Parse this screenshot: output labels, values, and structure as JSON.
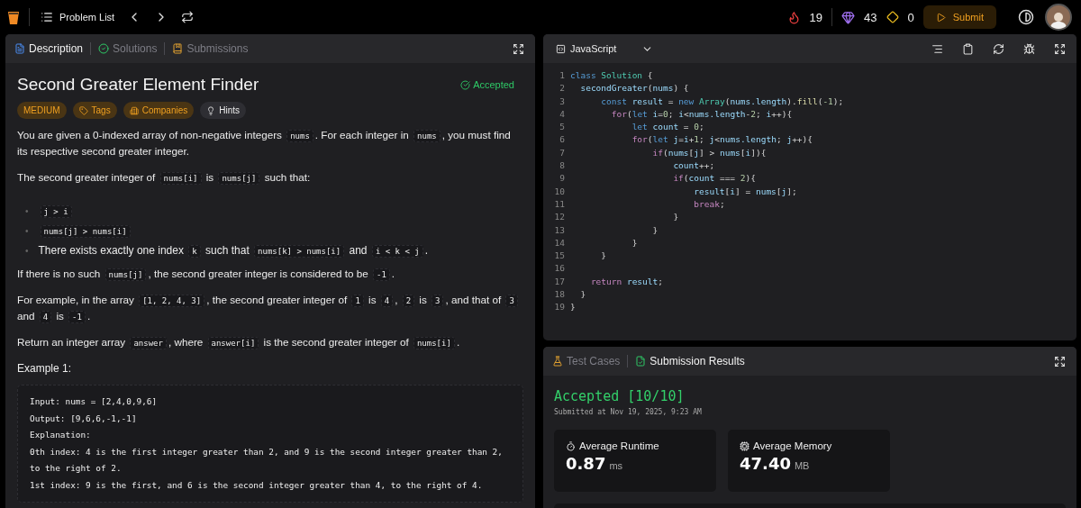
{
  "top_bar": {
    "nav_label": "Problem List",
    "streak": "19",
    "gems": "43",
    "diamonds": "0",
    "submit": "Submit"
  },
  "description_panel": {
    "tabs": [
      {
        "label": "Description",
        "selected": true
      },
      {
        "label": "Solutions",
        "selected": false
      },
      {
        "label": "Submissions",
        "selected": false
      }
    ],
    "title": "Second Greater Element Finder",
    "status": "Accepted",
    "tags": [
      {
        "label": "MEDIUM",
        "kind": "difficulty"
      },
      {
        "label": "Tags",
        "kind": "tags"
      },
      {
        "label": "Companies",
        "kind": "companies"
      },
      {
        "label": "Hints",
        "kind": "hints"
      }
    ],
    "content": [
      {
        "kind": "paragraph",
        "parts": [
          {
            "kind": "text",
            "text": "You are given a 0-indexed array of non-negative integers "
          },
          {
            "kind": "code",
            "text": "nums"
          },
          {
            "kind": "text",
            "text": ". For each integer in "
          },
          {
            "kind": "code",
            "text": "nums"
          },
          {
            "kind": "text",
            "text": ", you must find its respective second greater integer."
          }
        ]
      },
      {
        "kind": "paragraph",
        "parts": [
          {
            "kind": "text",
            "text": "The second greater integer of "
          },
          {
            "kind": "code",
            "text": "nums[i]"
          },
          {
            "kind": "text",
            "text": " is "
          },
          {
            "kind": "code",
            "text": "nums[j]"
          },
          {
            "kind": "text",
            "text": " such that:"
          }
        ]
      },
      {
        "kind": "bullets",
        "items": [
          {
            "marker": "•",
            "parts": [
              {
                "kind": "code",
                "text": "j > i"
              }
            ]
          },
          {
            "marker": "•",
            "parts": [
              {
                "kind": "code",
                "text": "nums[j] > nums[i]"
              }
            ]
          },
          {
            "marker": "•",
            "parts": [
              {
                "kind": "text",
                "text": "There exists exactly one index "
              },
              {
                "kind": "code",
                "text": "k"
              },
              {
                "kind": "text",
                "text": " such that "
              },
              {
                "kind": "code",
                "text": "nums[k] > nums[i]"
              },
              {
                "kind": "text",
                "text": " and "
              },
              {
                "kind": "code",
                "text": "i < k < j"
              },
              {
                "kind": "text",
                "text": "."
              }
            ]
          }
        ]
      },
      {
        "kind": "paragraph",
        "parts": [
          {
            "kind": "text",
            "text": "If there is no such "
          },
          {
            "kind": "code",
            "text": "nums[j]"
          },
          {
            "kind": "text",
            "text": ", the second greater integer is considered to be "
          },
          {
            "kind": "code",
            "text": "-1"
          },
          {
            "kind": "text",
            "text": "."
          }
        ]
      },
      {
        "kind": "paragraph",
        "parts": [
          {
            "kind": "text",
            "text": "For example, in the array "
          },
          {
            "kind": "code",
            "text": "[1, 2, 4, 3]"
          },
          {
            "kind": "text",
            "text": ", the second greater integer of "
          },
          {
            "kind": "code",
            "text": "1"
          },
          {
            "kind": "text",
            "text": " is "
          },
          {
            "kind": "code",
            "text": "4"
          },
          {
            "kind": "text",
            "text": ", "
          },
          {
            "kind": "code",
            "text": "2"
          },
          {
            "kind": "text",
            "text": " is "
          },
          {
            "kind": "code",
            "text": "3"
          },
          {
            "kind": "text",
            "text": ", and that of "
          },
          {
            "kind": "code",
            "text": "3"
          },
          {
            "kind": "text",
            "text": " and "
          },
          {
            "kind": "code",
            "text": "4"
          },
          {
            "kind": "text",
            "text": " is "
          },
          {
            "kind": "code",
            "text": "-1"
          },
          {
            "kind": "text",
            "text": "."
          }
        ]
      },
      {
        "kind": "paragraph",
        "parts": [
          {
            "kind": "text",
            "text": "Return an integer array "
          },
          {
            "kind": "code",
            "text": "answer"
          },
          {
            "kind": "text",
            "text": ", where "
          },
          {
            "kind": "code",
            "text": "answer[i]"
          },
          {
            "kind": "text",
            "text": " is the second greater integer of "
          },
          {
            "kind": "code",
            "text": "nums[i]"
          },
          {
            "kind": "text",
            "text": "."
          }
        ]
      },
      {
        "kind": "heading",
        "text": "Example 1:"
      },
      {
        "kind": "example",
        "lines": [
          "Input: nums = [2,4,0,9,6]",
          "Output: [9,6,6,-1,-1]",
          "Explanation:",
          "0th index: 4 is the first integer greater than 2, and 9 is the second integer greater than 2, to the right of 2.",
          "1st index: 9 is the first, and 6 is the second integer greater than 4, to the right of 4."
        ]
      }
    ]
  },
  "editor": {
    "language": "JavaScript",
    "lines": [
      {
        "number": "1",
        "tokens": [
          {
            "kind": "keyword",
            "text": "class "
          },
          {
            "kind": "class",
            "text": "Solution"
          },
          {
            "kind": "plain",
            "text": " {"
          }
        ]
      },
      {
        "number": "2",
        "tokens": [
          {
            "kind": "var",
            "text": "  secondGreater"
          },
          {
            "kind": "plain",
            "text": "("
          },
          {
            "kind": "var",
            "text": "nums"
          },
          {
            "kind": "plain",
            "text": ") {"
          }
        ]
      },
      {
        "number": "3",
        "tokens": [
          {
            "kind": "keyword",
            "text": "      const "
          },
          {
            "kind": "var",
            "text": "result"
          },
          {
            "kind": "plain",
            "text": " = "
          },
          {
            "kind": "keyword",
            "text": "new "
          },
          {
            "kind": "class",
            "text": "Array"
          },
          {
            "kind": "plain",
            "text": "("
          },
          {
            "kind": "var",
            "text": "nums.length"
          },
          {
            "kind": "plain",
            "text": ")."
          },
          {
            "kind": "func",
            "text": "fill"
          },
          {
            "kind": "plain",
            "text": "("
          },
          {
            "kind": "number",
            "text": "-1"
          },
          {
            "kind": "plain",
            "text": ");"
          }
        ]
      },
      {
        "number": "4",
        "tokens": [
          {
            "kind": "control",
            "text": "        for"
          },
          {
            "kind": "plain",
            "text": "("
          },
          {
            "kind": "keyword",
            "text": "let "
          },
          {
            "kind": "var",
            "text": "i"
          },
          {
            "kind": "plain",
            "text": "="
          },
          {
            "kind": "number",
            "text": "0"
          },
          {
            "kind": "plain",
            "text": "; "
          },
          {
            "kind": "var",
            "text": "i"
          },
          {
            "kind": "plain",
            "text": "<"
          },
          {
            "kind": "var",
            "text": "nums.length"
          },
          {
            "kind": "plain",
            "text": "-"
          },
          {
            "kind": "number",
            "text": "2"
          },
          {
            "kind": "plain",
            "text": "; "
          },
          {
            "kind": "var",
            "text": "i"
          },
          {
            "kind": "plain",
            "text": "++){"
          }
        ]
      },
      {
        "number": "5",
        "tokens": [
          {
            "kind": "keyword",
            "text": "            let "
          },
          {
            "kind": "var",
            "text": "count"
          },
          {
            "kind": "plain",
            "text": " = "
          },
          {
            "kind": "number",
            "text": "0"
          },
          {
            "kind": "plain",
            "text": ";"
          }
        ]
      },
      {
        "number": "6",
        "tokens": [
          {
            "kind": "control",
            "text": "            for"
          },
          {
            "kind": "plain",
            "text": "("
          },
          {
            "kind": "keyword",
            "text": "let "
          },
          {
            "kind": "var",
            "text": "j"
          },
          {
            "kind": "plain",
            "text": "="
          },
          {
            "kind": "var",
            "text": "i"
          },
          {
            "kind": "plain",
            "text": "+"
          },
          {
            "kind": "number",
            "text": "1"
          },
          {
            "kind": "plain",
            "text": "; "
          },
          {
            "kind": "var",
            "text": "j"
          },
          {
            "kind": "plain",
            "text": "<"
          },
          {
            "kind": "var",
            "text": "nums.length"
          },
          {
            "kind": "plain",
            "text": "; "
          },
          {
            "kind": "var",
            "text": "j"
          },
          {
            "kind": "plain",
            "text": "++){"
          }
        ]
      },
      {
        "number": "7",
        "tokens": [
          {
            "kind": "control",
            "text": "                if"
          },
          {
            "kind": "plain",
            "text": "("
          },
          {
            "kind": "var",
            "text": "nums"
          },
          {
            "kind": "plain",
            "text": "["
          },
          {
            "kind": "var",
            "text": "j"
          },
          {
            "kind": "plain",
            "text": "] > "
          },
          {
            "kind": "var",
            "text": "nums"
          },
          {
            "kind": "plain",
            "text": "["
          },
          {
            "kind": "var",
            "text": "i"
          },
          {
            "kind": "plain",
            "text": "]){"
          }
        ]
      },
      {
        "number": "8",
        "tokens": [
          {
            "kind": "var",
            "text": "                    count"
          },
          {
            "kind": "plain",
            "text": "++;"
          }
        ]
      },
      {
        "number": "9",
        "tokens": [
          {
            "kind": "control",
            "text": "                    if"
          },
          {
            "kind": "plain",
            "text": "("
          },
          {
            "kind": "var",
            "text": "count"
          },
          {
            "kind": "plain",
            "text": " === "
          },
          {
            "kind": "number",
            "text": "2"
          },
          {
            "kind": "plain",
            "text": "){"
          }
        ]
      },
      {
        "number": "10",
        "tokens": [
          {
            "kind": "var",
            "text": "                        result"
          },
          {
            "kind": "plain",
            "text": "["
          },
          {
            "kind": "var",
            "text": "i"
          },
          {
            "kind": "plain",
            "text": "] = "
          },
          {
            "kind": "var",
            "text": "nums"
          },
          {
            "kind": "plain",
            "text": "["
          },
          {
            "kind": "var",
            "text": "j"
          },
          {
            "kind": "plain",
            "text": "];"
          }
        ]
      },
      {
        "number": "11",
        "tokens": [
          {
            "kind": "control",
            "text": "                        break"
          },
          {
            "kind": "plain",
            "text": ";"
          }
        ]
      },
      {
        "number": "12",
        "tokens": [
          {
            "kind": "plain",
            "text": "                    }"
          }
        ]
      },
      {
        "number": "13",
        "tokens": [
          {
            "kind": "plain",
            "text": "                }"
          }
        ]
      },
      {
        "number": "14",
        "tokens": [
          {
            "kind": "plain",
            "text": "            }"
          }
        ]
      },
      {
        "number": "15",
        "tokens": [
          {
            "kind": "plain",
            "text": "      }"
          }
        ]
      },
      {
        "number": "16"
      },
      {
        "number": "17",
        "tokens": [
          {
            "kind": "control",
            "text": "    return "
          },
          {
            "kind": "var",
            "text": "result"
          },
          {
            "kind": "plain",
            "text": ";"
          }
        ]
      },
      {
        "number": "18",
        "tokens": [
          {
            "kind": "plain",
            "text": "  }"
          }
        ]
      },
      {
        "number": "19",
        "tokens": [
          {
            "kind": "plain",
            "text": "}"
          }
        ]
      }
    ]
  },
  "results_panel": {
    "tabs": [
      {
        "label": "Test Cases",
        "selected": false
      },
      {
        "label": "Submission Results",
        "selected": true
      }
    ],
    "verdict": "Accepted [10/10]",
    "submitted": "Submitted at Nov 19, 2025, 9:23 AM",
    "metrics": [
      {
        "kind": "runtime",
        "label": "Average Runtime",
        "value": "0.87",
        "unit": "ms"
      },
      {
        "kind": "memory",
        "label": "Average Memory",
        "value": "47.40",
        "unit": "MB"
      }
    ]
  }
}
